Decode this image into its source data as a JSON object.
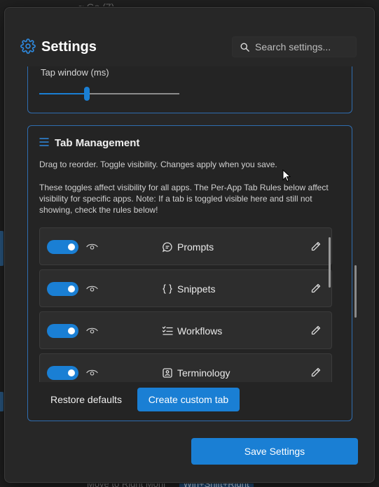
{
  "background": {
    "top_text": "≈ Go (7)",
    "bottom_text": "Move to Right Moni",
    "bottom_kbd": "Win+Shift+Right"
  },
  "header": {
    "title": "Settings",
    "icon": "gear-icon",
    "search_placeholder": "Search settings..."
  },
  "tap_window": {
    "label": "Tap window (ms)",
    "slider_fraction": 0.34
  },
  "tab_management": {
    "title": "Tab Management",
    "description": "Drag to reorder. Toggle visibility. Changes apply when you save.",
    "note": "These toggles affect visibility for all apps. The Per-App Tab Rules below affect visibility for specific apps. Note: If a tab is toggled visible here and still not showing, check the rules below!",
    "tabs": [
      {
        "label": "Prompts",
        "icon": "chat-bubble-icon",
        "visible": true
      },
      {
        "label": "Snippets",
        "icon": "braces-icon",
        "visible": true
      },
      {
        "label": "Workflows",
        "icon": "checklist-icon",
        "visible": true
      },
      {
        "label": "Terminology",
        "icon": "badge-icon",
        "visible": true
      }
    ],
    "restore_label": "Restore defaults",
    "create_label": "Create custom tab"
  },
  "footer": {
    "save_label": "Save Settings"
  },
  "colors": {
    "accent": "#1a7fd4",
    "dialog_bg": "#272727",
    "card_border": "#2f6db0"
  }
}
